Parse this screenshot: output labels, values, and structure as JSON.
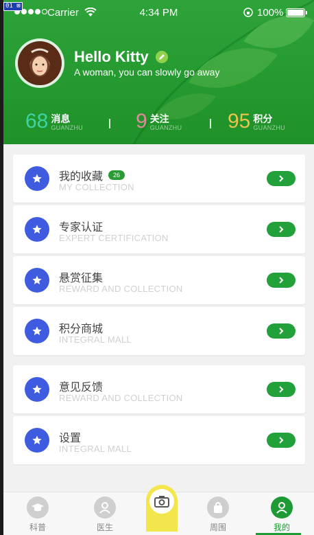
{
  "status_bar": {
    "carrier": "Carrier",
    "time": "4:34 PM",
    "battery": "100%"
  },
  "profile": {
    "greeting": "Hello Kitty",
    "subtitle": "A woman, you can slowly go away"
  },
  "stats": [
    {
      "value": "68",
      "label": "消息",
      "sub": "GUANZHU",
      "color": "#3fd3a3"
    },
    {
      "value": "9",
      "label": "关注",
      "sub": "GUANZHU",
      "color": "#e08a9a"
    },
    {
      "value": "95",
      "label": "积分",
      "sub": "GUANZHU",
      "color": "#e9c34a"
    }
  ],
  "menu": [
    {
      "title": "我的收藏",
      "sub": "MY COLLECTION",
      "badge": "26"
    },
    {
      "title": "专家认证",
      "sub": "EXPERT CERTIFICATION"
    },
    {
      "title": "悬赏征集",
      "sub": "REWARD AND COLLECTION"
    },
    {
      "title": "积分商城",
      "sub": "INTEGRAL MALL"
    },
    {
      "title": "意见反馈",
      "sub": "REWARD AND COLLECTION"
    },
    {
      "title": "设置",
      "sub": "INTEGRAL MALL"
    }
  ],
  "tabs": [
    {
      "label": "科普",
      "icon": "graduation-cap-icon"
    },
    {
      "label": "医生",
      "icon": "doctor-icon"
    },
    {
      "label": "",
      "icon": "camera-icon"
    },
    {
      "label": "周围",
      "icon": "bag-icon"
    },
    {
      "label": "我的",
      "icon": "user-icon"
    }
  ],
  "colors": {
    "header_green": "#23992f",
    "menu_icon_blue": "#3f5ce0",
    "action_green": "#22a03a",
    "camera_yellow": "#f3e64d"
  },
  "edge_badge": "01 ⊠"
}
